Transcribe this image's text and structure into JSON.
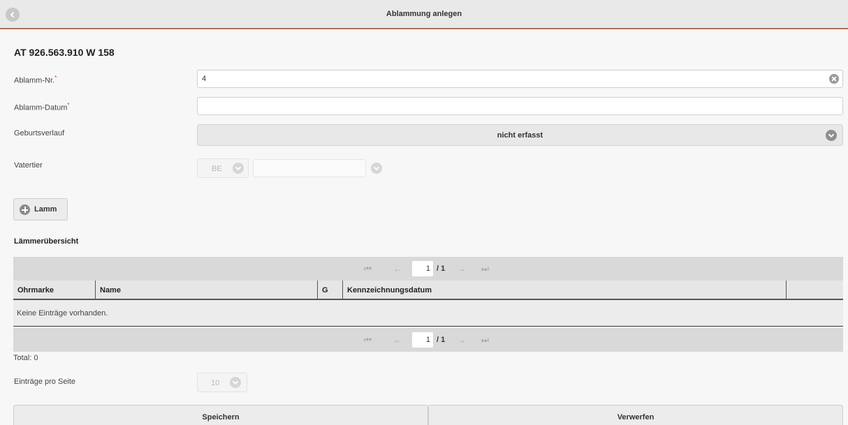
{
  "header": {
    "title": "Ablammung anlegen",
    "back_icon": "chevron-left-icon"
  },
  "animal": {
    "id": "AT 926.563.910 W 158"
  },
  "form": {
    "ablamm_nr": {
      "label": "Ablamm-Nr.",
      "required_mark": "*",
      "value": "4"
    },
    "ablamm_datum": {
      "label": "Ablamm-Datum",
      "required_mark": "*",
      "value": ""
    },
    "geburtsverlauf": {
      "label": "Geburtsverlauf",
      "value": "nicht erfasst"
    },
    "vatertier": {
      "label": "Vatertier",
      "country": "BE",
      "number": ""
    }
  },
  "add_lamb_button": {
    "label": "Lamm",
    "icon": "plus-circle-icon"
  },
  "overview": {
    "title": "Lämmerübersicht",
    "pager": {
      "first": "⏮",
      "prev": "←",
      "next": "→",
      "last": "⏭",
      "page": "1",
      "total": "/ 1"
    },
    "columns": [
      "Ohrmarke",
      "Name",
      "G",
      "Kennzeichnungsdatum",
      ""
    ],
    "empty_message": "Keine Einträge vorhanden.",
    "total": "Total: 0",
    "per_page": {
      "label": "Einträge pro Seite",
      "value": "10"
    }
  },
  "actions": {
    "save": "Speichern",
    "discard": "Verwerfen"
  },
  "colors": {
    "accent_line": "#b56f4e",
    "required": "#e0302c"
  }
}
